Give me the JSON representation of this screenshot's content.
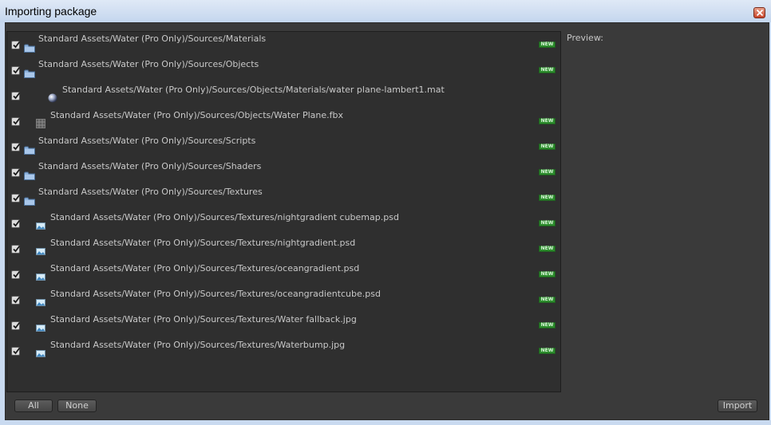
{
  "window": {
    "title": "Importing package"
  },
  "preview": {
    "label": "Preview:"
  },
  "buttons": {
    "all": "All",
    "none": "None",
    "import": "Import"
  },
  "badge_text": "NEW",
  "items": [
    {
      "path": "Standard Assets/Water (Pro Only)/Sources/Materials",
      "icon": "folder-icon",
      "indent": 0,
      "checked": true,
      "new": true
    },
    {
      "path": "Standard Assets/Water (Pro Only)/Sources/Objects",
      "icon": "folder-icon",
      "indent": 0,
      "checked": true,
      "new": true
    },
    {
      "path": "Standard Assets/Water (Pro Only)/Sources/Objects/Materials/water plane-lambert1.mat",
      "icon": "material-sphere-icon",
      "indent": 2,
      "checked": true,
      "new": false
    },
    {
      "path": "Standard Assets/Water (Pro Only)/Sources/Objects/Water Plane.fbx",
      "icon": "mesh-icon",
      "indent": 1,
      "checked": true,
      "new": true
    },
    {
      "path": "Standard Assets/Water (Pro Only)/Sources/Scripts",
      "icon": "folder-icon",
      "indent": 0,
      "checked": true,
      "new": true
    },
    {
      "path": "Standard Assets/Water (Pro Only)/Sources/Shaders",
      "icon": "folder-icon",
      "indent": 0,
      "checked": true,
      "new": true
    },
    {
      "path": "Standard Assets/Water (Pro Only)/Sources/Textures",
      "icon": "folder-icon",
      "indent": 0,
      "checked": true,
      "new": true
    },
    {
      "path": "Standard Assets/Water (Pro Only)/Sources/Textures/nightgradient cubemap.psd",
      "icon": "texture-icon",
      "indent": 1,
      "checked": true,
      "new": true
    },
    {
      "path": "Standard Assets/Water (Pro Only)/Sources/Textures/nightgradient.psd",
      "icon": "texture-icon",
      "indent": 1,
      "checked": true,
      "new": true
    },
    {
      "path": "Standard Assets/Water (Pro Only)/Sources/Textures/oceangradient.psd",
      "icon": "texture-icon",
      "indent": 1,
      "checked": true,
      "new": true
    },
    {
      "path": "Standard Assets/Water (Pro Only)/Sources/Textures/oceangradientcube.psd",
      "icon": "texture-icon",
      "indent": 1,
      "checked": true,
      "new": true
    },
    {
      "path": "Standard Assets/Water (Pro Only)/Sources/Textures/Water fallback.jpg",
      "icon": "texture-icon",
      "indent": 1,
      "checked": true,
      "new": true
    },
    {
      "path": "Standard Assets/Water (Pro Only)/Sources/Textures/Waterbump.jpg",
      "icon": "texture-icon",
      "indent": 1,
      "checked": true,
      "new": true
    }
  ]
}
